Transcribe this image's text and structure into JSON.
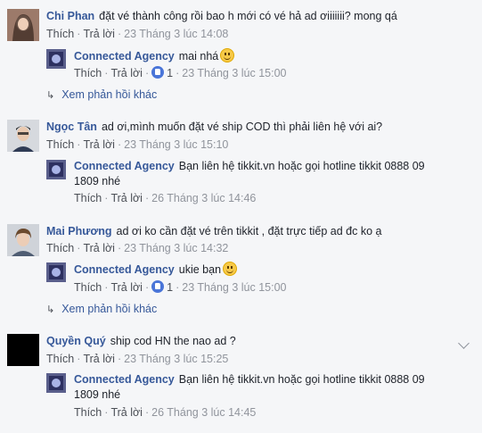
{
  "ui": {
    "like": "Thích",
    "reply": "Trả lời",
    "more_replies": "Xem phản hồi khác",
    "page_name": "Connected Agency"
  },
  "comments": [
    {
      "name": "Chi Phan",
      "text": "đặt vé thành công rồi bao h mới có vé hả ad ơiiiiiii? mong qá",
      "time": "23 Tháng 3 lúc 14:08",
      "reply": {
        "text": "mai nhá",
        "likes": "1",
        "time": "23 Tháng 3 lúc 15:00",
        "emoji": "smile-emoji"
      }
    },
    {
      "name": "Ngọc Tân",
      "text": "ad ơi,mình muốn đặt vé ship COD thì phải liên hệ với ai?",
      "time": "23 Tháng 3 lúc 15:10",
      "reply": {
        "text_line1": "Bạn liên hệ tikkit.vn hoặc gọi hotline tikkit 0888 09",
        "text_line2": "1809 nhé",
        "time": "26 Tháng 3 lúc 14:46"
      }
    },
    {
      "name": "Mai Phương",
      "text": "ad ơi ko cần đặt vé trên tikkit , đặt trực tiếp ad đc ko ạ",
      "time": "23 Tháng 3 lúc 14:32",
      "reply": {
        "text": "ukie bạn",
        "likes": "1",
        "time": "23 Tháng 3 lúc 15:00",
        "emoji": "smile-emoji"
      }
    },
    {
      "name": "Quyền Quý",
      "text": "ship cod HN the nao ad ?",
      "time": "23 Tháng 3 lúc 15:25",
      "reply": {
        "text_line1": "Bạn liên hệ tikkit.vn hoặc gọi hotline tikkit 0888 09",
        "text_line2": "1809 nhé",
        "time": "26 Tháng 3 lúc 14:45"
      }
    }
  ],
  "colors": {
    "link": "#365899",
    "meta": "#90949c",
    "background": "#f5f6f8"
  }
}
